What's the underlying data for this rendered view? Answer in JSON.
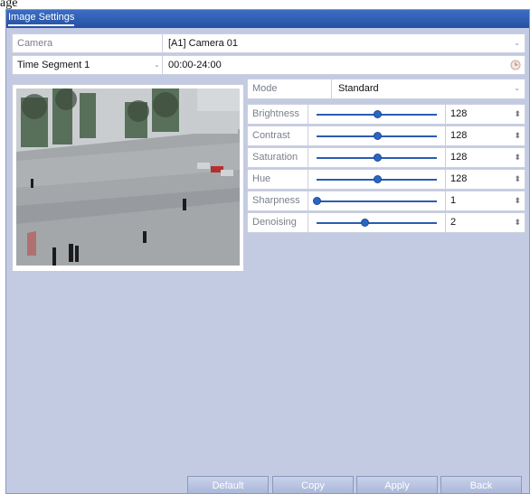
{
  "header_fragment": "age",
  "window": {
    "title": "Image Settings"
  },
  "camera": {
    "label": "Camera",
    "value": "[A1] Camera 01"
  },
  "time_segment": {
    "selected": "Time Segment 1",
    "range": "00:00-24:00"
  },
  "mode": {
    "label": "Mode",
    "value": "Standard"
  },
  "adjustments": [
    {
      "label": "Brightness",
      "value": "128",
      "level": 0.5
    },
    {
      "label": "Contrast",
      "value": "128",
      "level": 0.5
    },
    {
      "label": "Saturation",
      "value": "128",
      "level": 0.5
    },
    {
      "label": "Hue",
      "value": "128",
      "level": 0.5
    },
    {
      "label": "Sharpness",
      "value": "1",
      "level": 0.0
    },
    {
      "label": "Denoising",
      "value": "2",
      "level": 0.4
    }
  ],
  "buttons": {
    "default": "Default",
    "copy": "Copy",
    "apply": "Apply",
    "back": "Back"
  },
  "icons": {
    "dropdown": "chevron-down-icon",
    "clock": "clock-icon",
    "spinner": "spinner-arrows-icon"
  },
  "colors": {
    "titlebar": "#2f5fb6",
    "background": "#c3cbe3",
    "slider": "#2a5cb0",
    "button_text": "#ffffff"
  }
}
